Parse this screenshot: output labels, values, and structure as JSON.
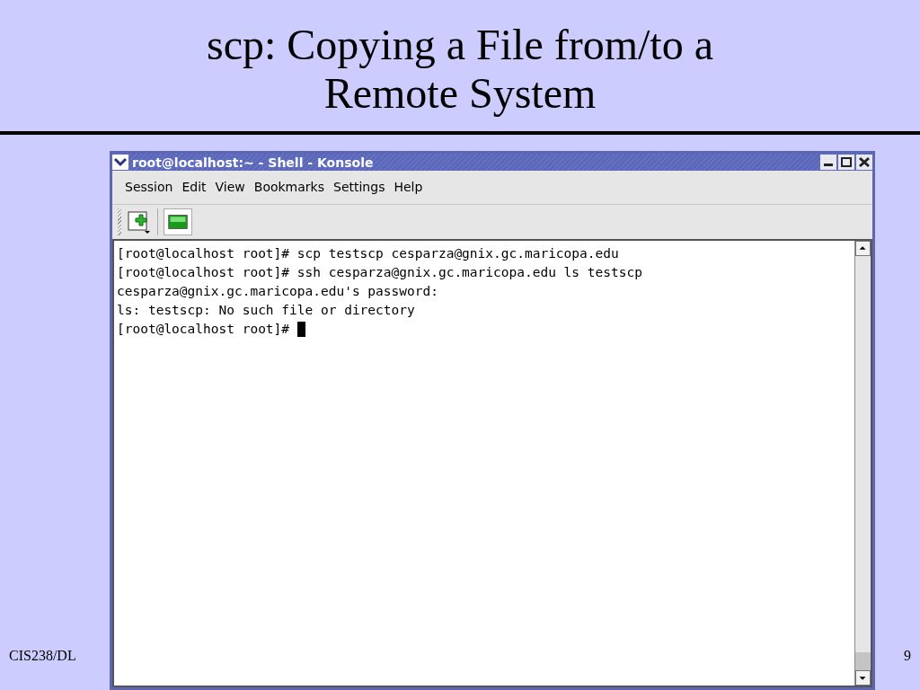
{
  "slide": {
    "title_lines": [
      "scp: Copying a File from/to a",
      "Remote System"
    ],
    "footer_left": "CIS238/DL",
    "page_number": "9"
  },
  "window": {
    "title": "root@localhost:~ - Shell - Konsole",
    "menu": [
      "Session",
      "Edit",
      "View",
      "Bookmarks",
      "Settings",
      "Help"
    ],
    "terminal_lines": [
      "[root@localhost root]# scp testscp cesparza@gnix.gc.maricopa.edu",
      "[root@localhost root]# ssh cesparza@gnix.gc.maricopa.edu ls testscp",
      "cesparza@gnix.gc.maricopa.edu's password:",
      "ls: testscp: No such file or directory",
      "[root@localhost root]# "
    ]
  }
}
